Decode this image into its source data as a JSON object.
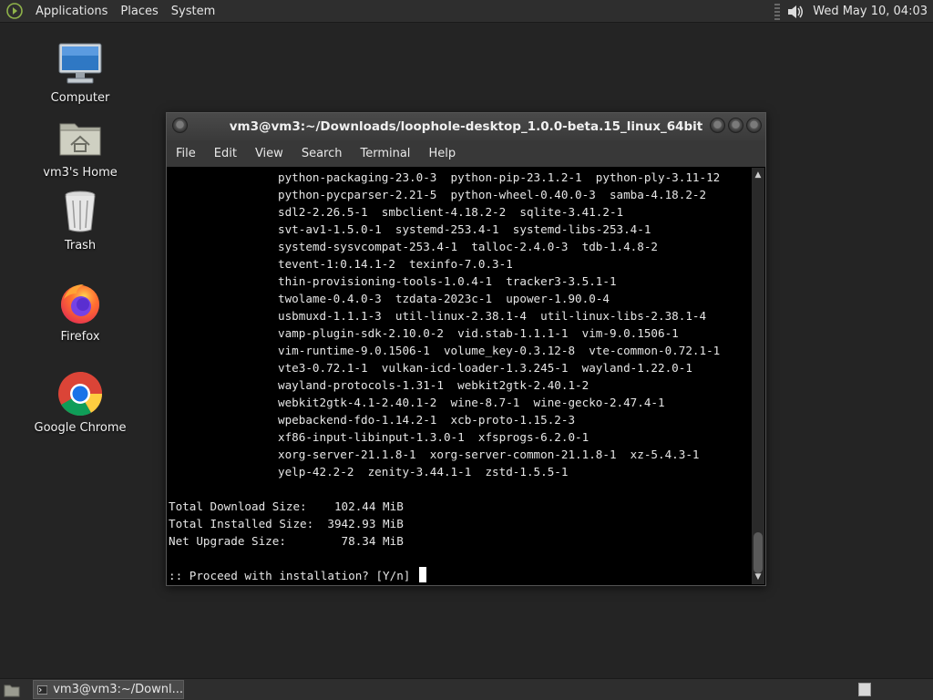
{
  "top_panel": {
    "menu": [
      "Applications",
      "Places",
      "System"
    ],
    "clock": "Wed May 10, 04:03"
  },
  "desktop_icons": [
    {
      "label": "Computer",
      "icon": "computer-icon"
    },
    {
      "label": "vm3's Home",
      "icon": "home-folder-icon"
    },
    {
      "label": "Trash",
      "icon": "trash-icon"
    },
    {
      "label": "Firefox",
      "icon": "firefox-icon"
    },
    {
      "label": "Google Chrome",
      "icon": "chrome-icon"
    }
  ],
  "window": {
    "title": "vm3@vm3:~/Downloads/loophole-desktop_1.0.0-beta.15_linux_64bit",
    "menu": [
      "File",
      "Edit",
      "View",
      "Search",
      "Terminal",
      "Help"
    ]
  },
  "terminal": {
    "package_lines": [
      "python-packaging-23.0-3  python-pip-23.1.2-1  python-ply-3.11-12",
      "python-pycparser-2.21-5  python-wheel-0.40.0-3  samba-4.18.2-2",
      "sdl2-2.26.5-1  smbclient-4.18.2-2  sqlite-3.41.2-1",
      "svt-av1-1.5.0-1  systemd-253.4-1  systemd-libs-253.4-1",
      "systemd-sysvcompat-253.4-1  talloc-2.4.0-3  tdb-1.4.8-2",
      "tevent-1:0.14.1-2  texinfo-7.0.3-1",
      "thin-provisioning-tools-1.0.4-1  tracker3-3.5.1-1",
      "twolame-0.4.0-3  tzdata-2023c-1  upower-1.90.0-4",
      "usbmuxd-1.1.1-3  util-linux-2.38.1-4  util-linux-libs-2.38.1-4",
      "vamp-plugin-sdk-2.10.0-2  vid.stab-1.1.1-1  vim-9.0.1506-1",
      "vim-runtime-9.0.1506-1  volume_key-0.3.12-8  vte-common-0.72.1-1",
      "vte3-0.72.1-1  vulkan-icd-loader-1.3.245-1  wayland-1.22.0-1",
      "wayland-protocols-1.31-1  webkit2gtk-2.40.1-2",
      "webkit2gtk-4.1-2.40.1-2  wine-8.7-1  wine-gecko-2.47.4-1",
      "wpebackend-fdo-1.14.2-1  xcb-proto-1.15.2-3",
      "xf86-input-libinput-1.3.0-1  xfsprogs-6.2.0-1",
      "xorg-server-21.1.8-1  xorg-server-common-21.1.8-1  xz-5.4.3-1",
      "yelp-42.2-2  zenity-3.44.1-1  zstd-1.5.5-1"
    ],
    "summary": [
      "Total Download Size:    102.44 MiB",
      "Total Installed Size:  3942.93 MiB",
      "Net Upgrade Size:        78.34 MiB"
    ],
    "prompt": ":: Proceed with installation? [Y/n] "
  },
  "bottom_panel": {
    "task_label": "vm3@vm3:~/Downl..."
  }
}
